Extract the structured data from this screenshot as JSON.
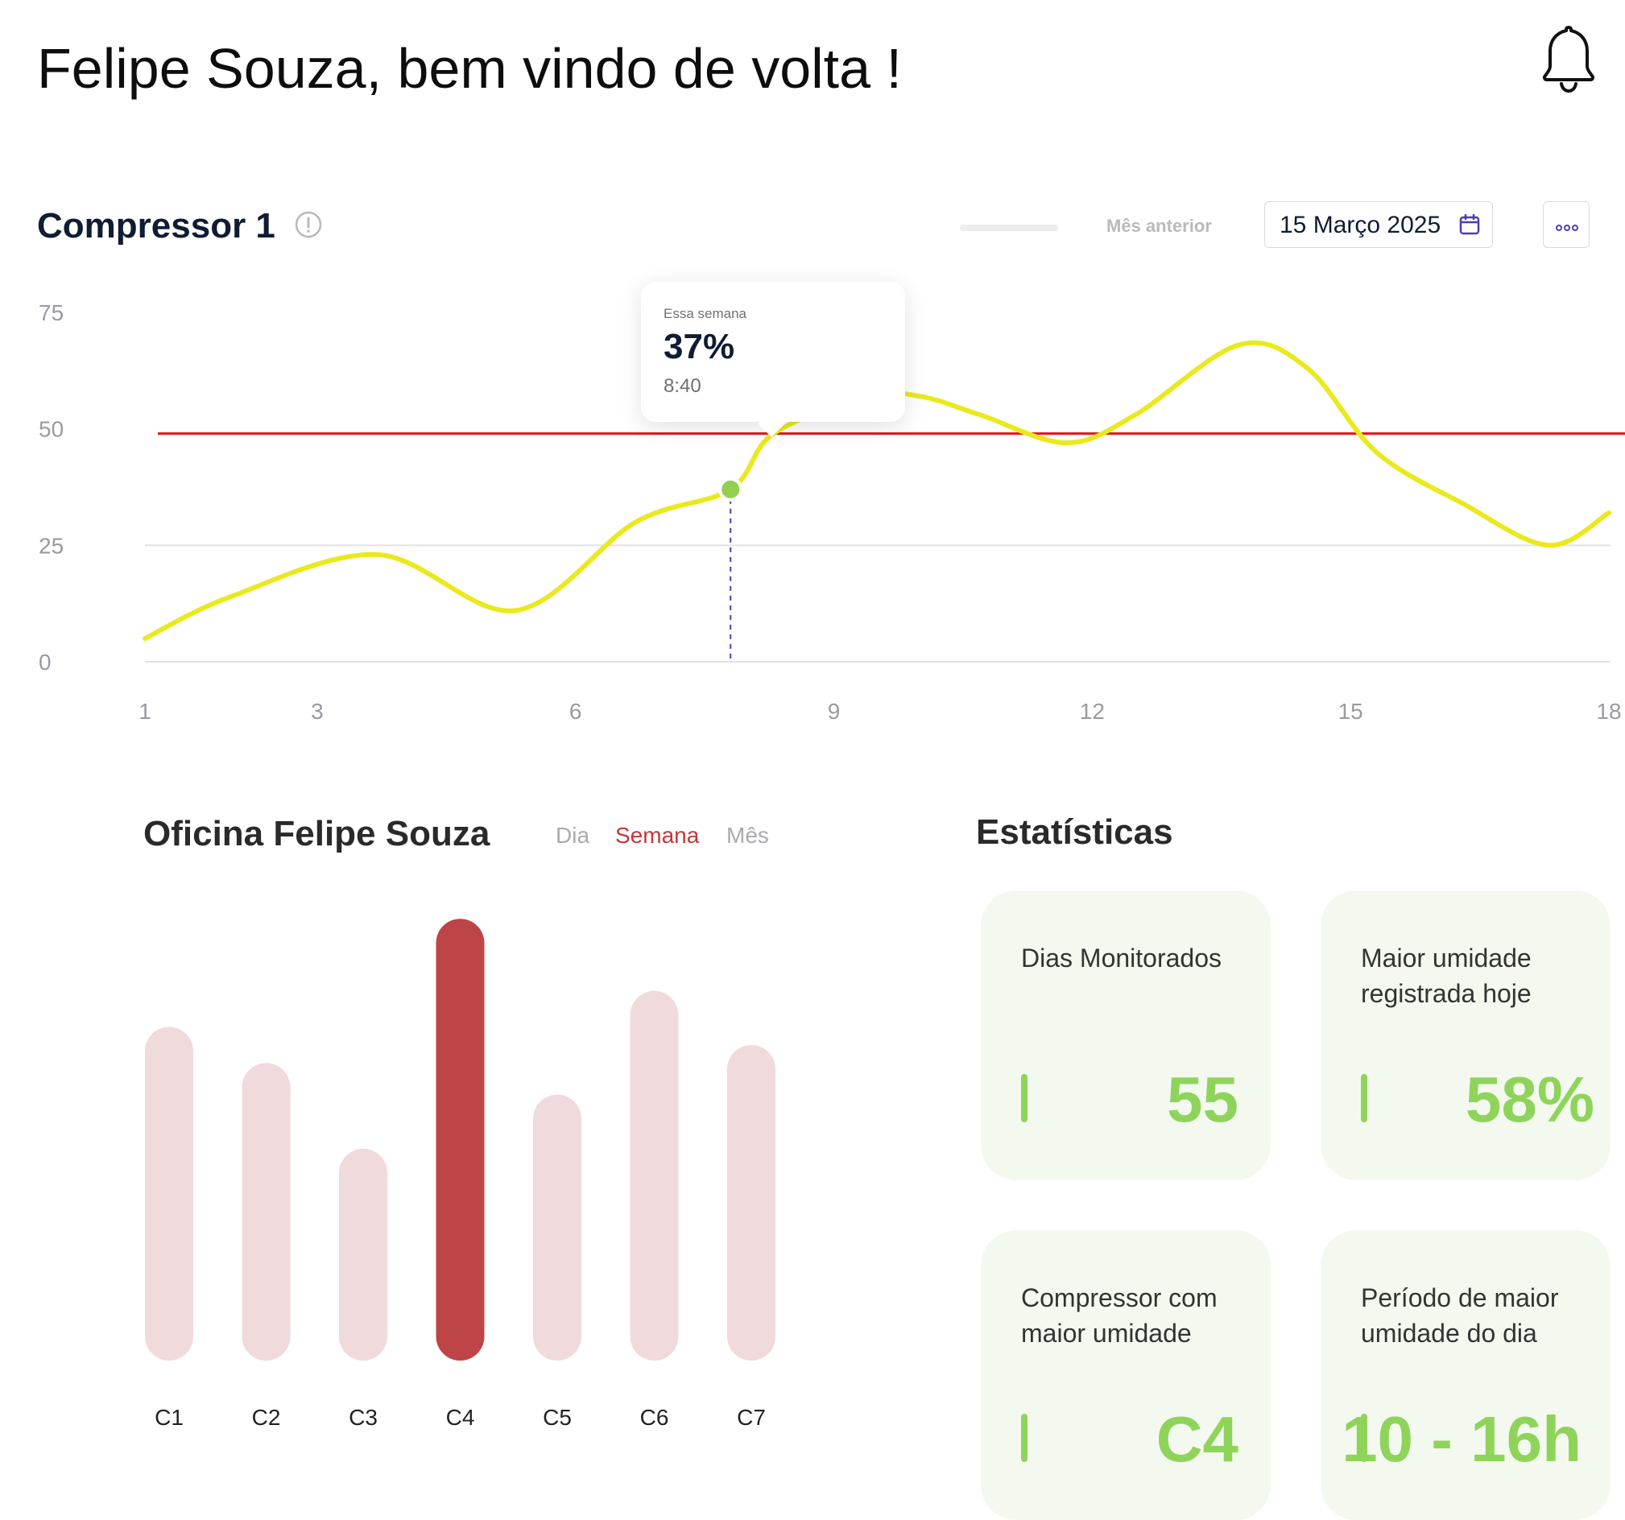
{
  "header": {
    "greeting": "Felipe Souza, bem vindo de volta !",
    "bell_icon": "bell-icon"
  },
  "compressor_card": {
    "title": "Compressor 1",
    "info_icon": "info-icon",
    "legend_previous": "Mês anterior",
    "date": "15 Março 2025",
    "calendar_icon": "calendar-icon",
    "more_icon": "more-options-icon",
    "tooltip": {
      "label": "Essa semana",
      "value": "37%",
      "time": "8:40"
    }
  },
  "workshop": {
    "title": "Oficina  Felipe Souza",
    "tabs": [
      {
        "label": "Dia",
        "active": false
      },
      {
        "label": "Semana",
        "active": true
      },
      {
        "label": "Mês",
        "active": false
      }
    ]
  },
  "stats": {
    "title": "Estatísticas",
    "cards": [
      {
        "label": "Dias  Monitorados",
        "value": "55"
      },
      {
        "label": "Maior umidade registrada  hoje",
        "value": "58%"
      },
      {
        "label": "Compressor com maior umidade",
        "value": "C4"
      },
      {
        "label": "Período de maior umidade do dia",
        "value": "10 - 16h"
      }
    ]
  },
  "colors": {
    "line": "#e9e91e",
    "threshold": "#e8161a",
    "highlight_point": "#92d050",
    "bar_highlight": "#bd4548",
    "bar_default": "#f1dadc",
    "tab_active": "#c0383b",
    "tab_inactive": "#a9a9b3",
    "stat_accent": "#8fd45a"
  },
  "chart_data": [
    {
      "type": "line",
      "title": "Compressor 1",
      "xlabel": "",
      "ylabel": "",
      "xlim": [
        1,
        18
      ],
      "ylim": [
        0,
        75
      ],
      "xticks": [
        1,
        3,
        6,
        9,
        12,
        15,
        18
      ],
      "yticks": [
        0,
        25,
        50,
        75
      ],
      "grid": "horizontal",
      "threshold": 49,
      "series": [
        {
          "x": [
            1,
            2,
            3.7,
            5.3,
            6.7,
            7.8,
            8.3,
            9.4,
            10,
            10.7,
            11.7,
            12.5,
            13.7,
            14.5,
            15.3,
            16.3,
            17.3,
            18
          ],
          "y": [
            5,
            14,
            23,
            11,
            30,
            37,
            49,
            57,
            57,
            53,
            47,
            53,
            68,
            63,
            45,
            34,
            25,
            32
          ]
        }
      ],
      "highlight": {
        "x": 7.8,
        "y": 37
      }
    },
    {
      "type": "bar",
      "title": "",
      "categories": [
        "C1",
        "C2",
        "C3",
        "C4",
        "C5",
        "C6",
        "C7"
      ],
      "values": [
        74,
        66,
        47,
        98,
        59,
        82,
        70
      ],
      "ylim": [
        0,
        100
      ],
      "highlight_index": 3
    }
  ]
}
